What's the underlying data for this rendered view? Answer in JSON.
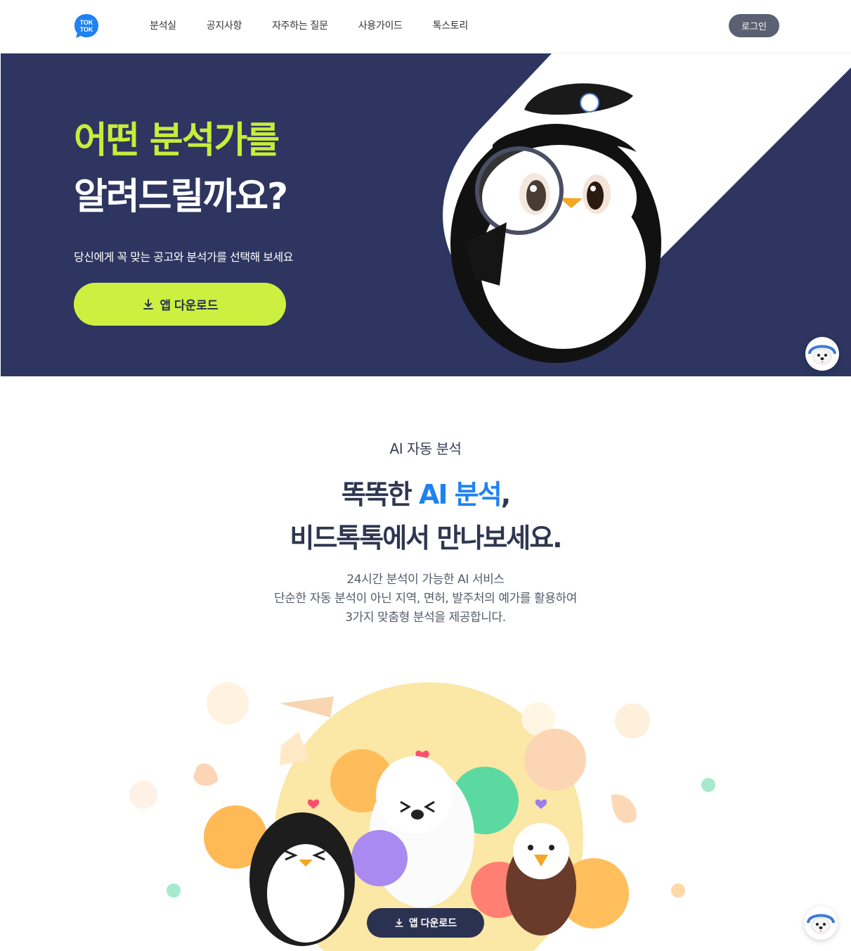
{
  "brand": {
    "logo_text_top": "TOK",
    "logo_text_bottom": "TOK",
    "accent": "#1e82f0"
  },
  "nav": {
    "items": [
      {
        "label": "분석실"
      },
      {
        "label": "공지사항"
      },
      {
        "label": "자주하는 질문"
      },
      {
        "label": "사용가이드"
      },
      {
        "label": "톡스토리"
      }
    ],
    "login_label": "로그인"
  },
  "hero": {
    "title_line1": "어떤 분석가를",
    "title_line2": "알려드릴까요?",
    "subtitle": "당신에게 꼭 맞는 공고와 분석가를 선택해 보세요",
    "download_label": "앱 다운로드",
    "download_icon": "download-icon",
    "colors": {
      "background": "#2d3560",
      "highlight": "#c8ec3a",
      "button": "#cdf040"
    }
  },
  "ai_section": {
    "eyebrow": "AI 자동 분석",
    "headline_part1": "똑똑한 ",
    "headline_accent": "AI 분석",
    "headline_part2": ",",
    "headline_line2": "비드톡톡에서 만나보세요.",
    "desc_lines": [
      "24시간 분석이 가능한 AI 서비스",
      "단순한 자동 분석이 아닌 지역, 면허, 발주처의 예가를 활용하여",
      "3가지 맞춤형 분석을 제공합니다."
    ]
  },
  "floating_download": {
    "label": "앱 다운로드",
    "icon": "download-icon"
  },
  "helper": {
    "icon": "dog-mascot-icon"
  }
}
